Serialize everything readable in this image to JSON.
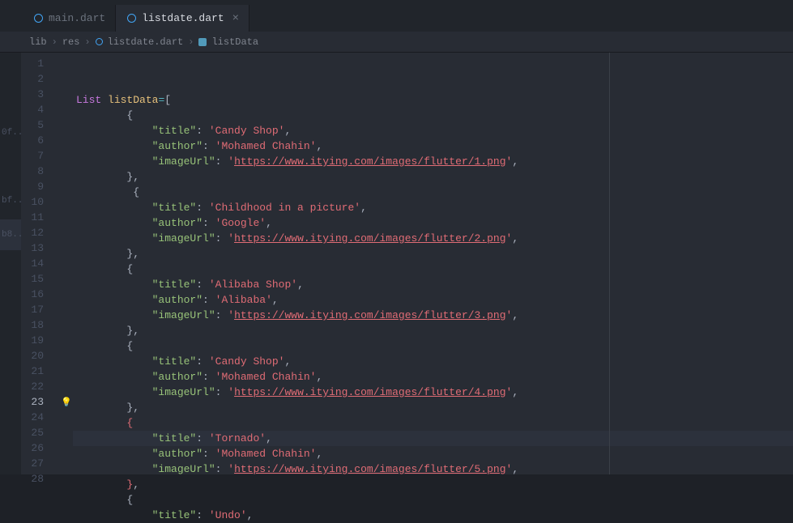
{
  "tabs": [
    {
      "name": "main.dart",
      "active": false
    },
    {
      "name": "listdate.dart",
      "active": true
    }
  ],
  "breadcrumbs": {
    "parts": [
      "lib",
      "res",
      "listdate.dart",
      "listData"
    ]
  },
  "edgeItems": [
    "0f...",
    "",
    "bf...",
    "b8..."
  ],
  "currentLine": 23,
  "lines": [
    {
      "num": 1,
      "tokens": [
        {
          "t": "List",
          "c": "kw"
        },
        {
          "t": " "
        },
        {
          "t": "listData",
          "c": "fn"
        },
        {
          "t": "=",
          "c": "op"
        },
        {
          "t": "[",
          "c": "punct"
        }
      ]
    },
    {
      "num": 2,
      "indent": 8,
      "tokens": [
        {
          "t": "{",
          "c": "punct"
        }
      ]
    },
    {
      "num": 3,
      "indent": 12,
      "tokens": [
        {
          "t": "\"title\"",
          "c": "key"
        },
        {
          "t": ": "
        },
        {
          "t": "'Candy Shop'",
          "c": "str"
        },
        {
          "t": ",",
          "c": "punct"
        }
      ]
    },
    {
      "num": 4,
      "indent": 12,
      "tokens": [
        {
          "t": "\"author\"",
          "c": "key"
        },
        {
          "t": ": "
        },
        {
          "t": "'Mohamed Chahin'",
          "c": "str"
        },
        {
          "t": ",",
          "c": "punct"
        }
      ]
    },
    {
      "num": 5,
      "indent": 12,
      "tokens": [
        {
          "t": "\"imageUrl\"",
          "c": "key"
        },
        {
          "t": ": "
        },
        {
          "t": "'",
          "c": "str"
        },
        {
          "t": "https://www.itying.com/images/flutter/1.png",
          "c": "str url"
        },
        {
          "t": "'",
          "c": "str"
        },
        {
          "t": ",",
          "c": "punct"
        }
      ]
    },
    {
      "num": 6,
      "indent": 8,
      "tokens": [
        {
          "t": "},",
          "c": "punct"
        }
      ]
    },
    {
      "num": 7,
      "indent": 9,
      "tokens": [
        {
          "t": "{",
          "c": "punct"
        }
      ]
    },
    {
      "num": 8,
      "indent": 12,
      "tokens": [
        {
          "t": "\"title\"",
          "c": "key"
        },
        {
          "t": ": "
        },
        {
          "t": "'Childhood in a picture'",
          "c": "str"
        },
        {
          "t": ",",
          "c": "punct"
        }
      ]
    },
    {
      "num": 9,
      "indent": 12,
      "tokens": [
        {
          "t": "\"author\"",
          "c": "key"
        },
        {
          "t": ": "
        },
        {
          "t": "'Google'",
          "c": "str"
        },
        {
          "t": ",",
          "c": "punct"
        }
      ]
    },
    {
      "num": 10,
      "indent": 12,
      "tokens": [
        {
          "t": "\"imageUrl\"",
          "c": "key"
        },
        {
          "t": ": "
        },
        {
          "t": "'",
          "c": "str"
        },
        {
          "t": "https://www.itying.com/images/flutter/2.png",
          "c": "str url"
        },
        {
          "t": "'",
          "c": "str"
        },
        {
          "t": ",",
          "c": "punct"
        }
      ]
    },
    {
      "num": 11,
      "indent": 8,
      "tokens": [
        {
          "t": "},",
          "c": "punct"
        }
      ]
    },
    {
      "num": 12,
      "indent": 8,
      "tokens": [
        {
          "t": "{",
          "c": "punct"
        }
      ]
    },
    {
      "num": 13,
      "indent": 12,
      "tokens": [
        {
          "t": "\"title\"",
          "c": "key"
        },
        {
          "t": ": "
        },
        {
          "t": "'Alibaba Shop'",
          "c": "str"
        },
        {
          "t": ",",
          "c": "punct"
        }
      ]
    },
    {
      "num": 14,
      "indent": 12,
      "tokens": [
        {
          "t": "\"author\"",
          "c": "key"
        },
        {
          "t": ": "
        },
        {
          "t": "'Alibaba'",
          "c": "str"
        },
        {
          "t": ",",
          "c": "punct"
        }
      ]
    },
    {
      "num": 15,
      "indent": 12,
      "tokens": [
        {
          "t": "\"imageUrl\"",
          "c": "key"
        },
        {
          "t": ": "
        },
        {
          "t": "'",
          "c": "str"
        },
        {
          "t": "https://www.itying.com/images/flutter/3.png",
          "c": "str url"
        },
        {
          "t": "'",
          "c": "str"
        },
        {
          "t": ",",
          "c": "punct"
        }
      ]
    },
    {
      "num": 16,
      "indent": 8,
      "tokens": [
        {
          "t": "},",
          "c": "punct"
        }
      ]
    },
    {
      "num": 17,
      "indent": 8,
      "tokens": [
        {
          "t": "{",
          "c": "punct"
        }
      ]
    },
    {
      "num": 18,
      "indent": 12,
      "tokens": [
        {
          "t": "\"title\"",
          "c": "key"
        },
        {
          "t": ": "
        },
        {
          "t": "'Candy Shop'",
          "c": "str"
        },
        {
          "t": ",",
          "c": "punct"
        }
      ]
    },
    {
      "num": 19,
      "indent": 12,
      "tokens": [
        {
          "t": "\"author\"",
          "c": "key"
        },
        {
          "t": ": "
        },
        {
          "t": "'Mohamed Chahin'",
          "c": "str"
        },
        {
          "t": ",",
          "c": "punct"
        }
      ]
    },
    {
      "num": 20,
      "indent": 12,
      "tokens": [
        {
          "t": "\"imageUrl\"",
          "c": "key"
        },
        {
          "t": ": "
        },
        {
          "t": "'",
          "c": "str"
        },
        {
          "t": "https://www.itying.com/images/flutter/4.png",
          "c": "str url"
        },
        {
          "t": "'",
          "c": "str"
        },
        {
          "t": ",",
          "c": "punct"
        }
      ]
    },
    {
      "num": 21,
      "indent": 8,
      "tokens": [
        {
          "t": "},",
          "c": "punct"
        }
      ]
    },
    {
      "num": 22,
      "indent": 8,
      "tokens": [
        {
          "t": "{",
          "c": "brace-hl"
        }
      ]
    },
    {
      "num": 23,
      "indent": 12,
      "tokens": [
        {
          "t": "\"title\"",
          "c": "key"
        },
        {
          "t": ": "
        },
        {
          "t": "'Tornado'",
          "c": "str"
        },
        {
          "t": ",",
          "c": "punct"
        }
      ]
    },
    {
      "num": 24,
      "indent": 12,
      "tokens": [
        {
          "t": "\"author\"",
          "c": "key"
        },
        {
          "t": ": "
        },
        {
          "t": "'Mohamed Chahin'",
          "c": "str"
        },
        {
          "t": ",",
          "c": "punct"
        }
      ]
    },
    {
      "num": 25,
      "indent": 12,
      "tokens": [
        {
          "t": "\"imageUrl\"",
          "c": "key"
        },
        {
          "t": ": "
        },
        {
          "t": "'",
          "c": "str"
        },
        {
          "t": "https://www.itying.com/images/flutter/5.png",
          "c": "str url"
        },
        {
          "t": "'",
          "c": "str"
        },
        {
          "t": ",",
          "c": "punct"
        }
      ]
    },
    {
      "num": 26,
      "indent": 8,
      "tokens": [
        {
          "t": "}",
          "c": "brace-hl"
        },
        {
          "t": ",",
          "c": "punct"
        }
      ]
    },
    {
      "num": 27,
      "indent": 8,
      "tokens": [
        {
          "t": "{",
          "c": "punct"
        }
      ]
    },
    {
      "num": 28,
      "indent": 12,
      "tokens": [
        {
          "t": "\"title\"",
          "c": "key"
        },
        {
          "t": ": "
        },
        {
          "t": "'Undo'",
          "c": "str"
        },
        {
          "t": ",",
          "c": "punct"
        }
      ]
    }
  ]
}
